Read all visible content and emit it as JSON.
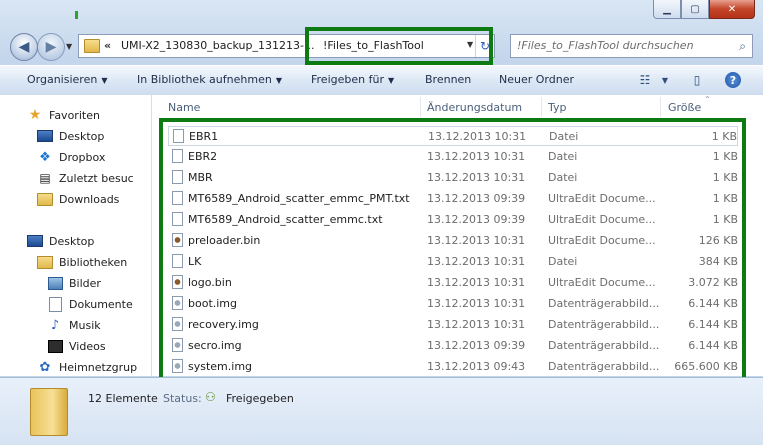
{
  "window": {
    "caption_buttons": [
      "minimize",
      "maximize",
      "close"
    ]
  },
  "address": {
    "chevron": "«",
    "crumbs": [
      "UMI-X2_130830_backup_131213-...",
      "!Files_to_FlashTool"
    ],
    "search_placeholder": "!Files_to_FlashTool durchsuchen"
  },
  "toolbar": {
    "organize": "Organisieren",
    "include_library": "In Bibliothek aufnehmen",
    "share": "Freigeben für",
    "burn": "Brennen",
    "new_folder": "Neuer Ordner"
  },
  "sidebar": {
    "favorites_label": "Favoriten",
    "favorites": [
      "Desktop",
      "Dropbox",
      "Zuletzt besuc",
      "Downloads"
    ],
    "desktop_label": "Desktop",
    "libraries_label": "Bibliotheken",
    "libraries": [
      "Bilder",
      "Dokumente",
      "Musik",
      "Videos"
    ],
    "network_label": "Heimnetzgrup"
  },
  "columns": {
    "name": "Name",
    "date": "Änderungsdatum",
    "type": "Typ",
    "size": "Größe"
  },
  "files": [
    {
      "name": "EBR1",
      "date": "13.12.2013 10:31",
      "type": "Datei",
      "size": "1 KB",
      "icon": "file-icon"
    },
    {
      "name": "EBR2",
      "date": "13.12.2013 10:31",
      "type": "Datei",
      "size": "1 KB",
      "icon": "file-icon"
    },
    {
      "name": "MBR",
      "date": "13.12.2013 10:31",
      "type": "Datei",
      "size": "1 KB",
      "icon": "file-icon"
    },
    {
      "name": "MT6589_Android_scatter_emmc_PMT.txt",
      "date": "13.12.2013 09:39",
      "type": "UltraEdit Docume...",
      "size": "1 KB",
      "icon": "file-icon"
    },
    {
      "name": "MT6589_Android_scatter_emmc.txt",
      "date": "13.12.2013 09:39",
      "type": "UltraEdit Docume...",
      "size": "1 KB",
      "icon": "file-icon"
    },
    {
      "name": "preloader.bin",
      "date": "13.12.2013 10:31",
      "type": "UltraEdit Docume...",
      "size": "126 KB",
      "icon": "bin-icon"
    },
    {
      "name": "LK",
      "date": "13.12.2013 10:31",
      "type": "Datei",
      "size": "384 KB",
      "icon": "file-icon"
    },
    {
      "name": "logo.bin",
      "date": "13.12.2013 10:31",
      "type": "UltraEdit Docume...",
      "size": "3.072 KB",
      "icon": "bin-icon"
    },
    {
      "name": "boot.img",
      "date": "13.12.2013 10:31",
      "type": "Datenträgerabbild...",
      "size": "6.144 KB",
      "icon": "disk-image-icon"
    },
    {
      "name": "recovery.img",
      "date": "13.12.2013 10:31",
      "type": "Datenträgerabbild...",
      "size": "6.144 KB",
      "icon": "disk-image-icon"
    },
    {
      "name": "secro.img",
      "date": "13.12.2013 09:39",
      "type": "Datenträgerabbild...",
      "size": "6.144 KB",
      "icon": "disk-image-icon"
    },
    {
      "name": "system.img",
      "date": "13.12.2013 09:43",
      "type": "Datenträgerabbild...",
      "size": "665.600 KB",
      "icon": "disk-image-icon"
    }
  ],
  "status": {
    "count": "12 Elemente",
    "label": "Status:",
    "value": "Freigegeben"
  },
  "colors": {
    "highlight": "#0d7a12",
    "window_chrome": "#c4d6ec"
  }
}
